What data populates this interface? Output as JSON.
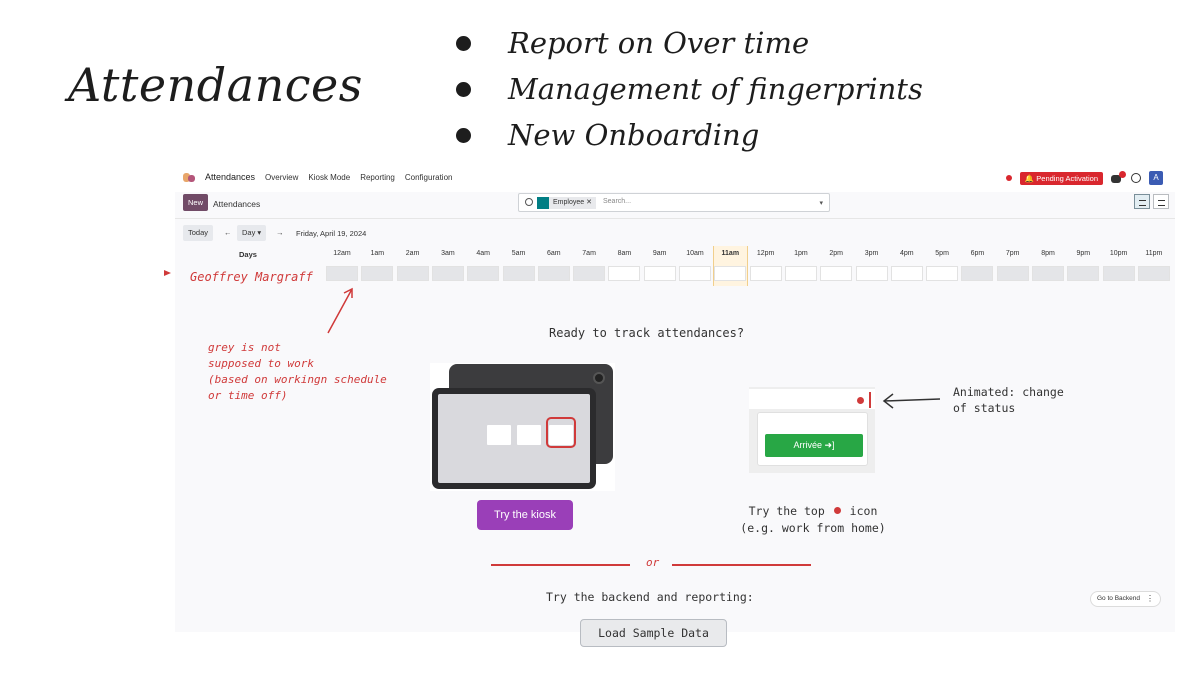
{
  "slide": {
    "title": "Attendances",
    "bullets": [
      "Report on Over time",
      "Management of fingerprints",
      "New Onboarding"
    ]
  },
  "navbar": {
    "app_name": "Attendances",
    "menu": [
      "Overview",
      "Kiosk Mode",
      "Reporting",
      "Configuration"
    ],
    "pending_label": "Pending Activation",
    "avatar_letter": "A"
  },
  "control": {
    "new_label": "New",
    "breadcrumb": "Attendances",
    "facet": "Employee",
    "search_placeholder": "Search..."
  },
  "toolbar": {
    "today": "Today",
    "prev": "←",
    "scale": "Day ▾",
    "next": "→",
    "date": "Friday, April 19, 2024"
  },
  "gantt": {
    "days_header": "Days",
    "hours": [
      "12am",
      "1am",
      "2am",
      "3am",
      "4am",
      "5am",
      "6am",
      "7am",
      "8am",
      "9am",
      "10am",
      "11am",
      "12pm",
      "1pm",
      "2pm",
      "3pm",
      "4pm",
      "5pm",
      "6pm",
      "7pm",
      "8pm",
      "9pm",
      "10pm",
      "11pm"
    ],
    "employee": "Geoffrey Margraff",
    "current_hour": "11am"
  },
  "annotations": {
    "grey_note": [
      "grey is not",
      "supposed to work",
      "(based on workingn schedule",
      "or time off)"
    ],
    "ready": "Ready to track attendances?",
    "animated": [
      "Animated: change",
      "of status"
    ],
    "try_top_line1_a": "Try the top",
    "try_top_line1_b": "icon",
    "try_top_line2": "(e.g. work from home)",
    "or": "or",
    "try_backend": "Try the backend and reporting:"
  },
  "buttons": {
    "kiosk": "Try the kiosk",
    "load_sample": "Load Sample Data",
    "go_backend": "Go to Backend",
    "arrivee": "Arrivée ➜]",
    "more": "⋮"
  },
  "colors": {
    "annotation_red": "#d03a3a",
    "odoo_purple": "#714b67",
    "kiosk_purple": "#9a3fb8",
    "arrivee_green": "#28a745",
    "pending_red": "#d9272e"
  }
}
